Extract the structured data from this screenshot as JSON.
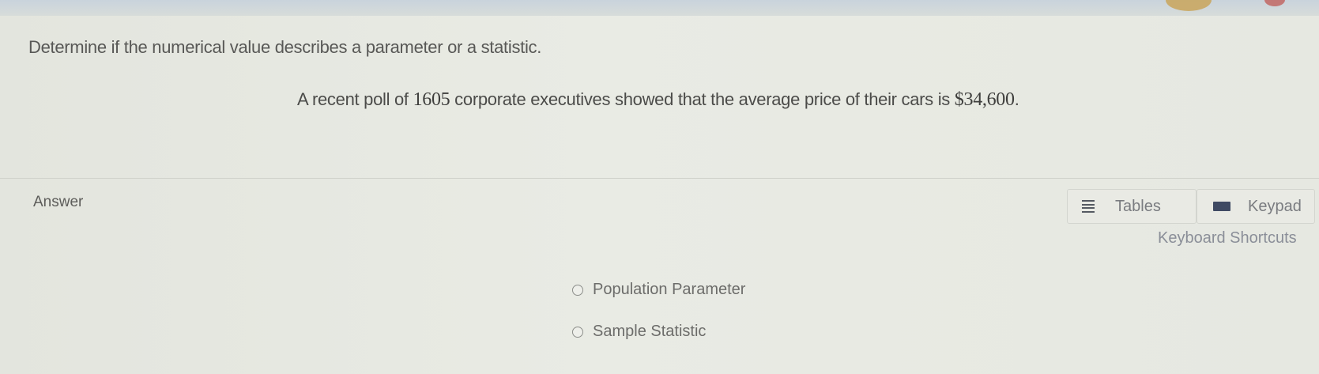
{
  "question": {
    "instruction": "Determine if the numerical value describes a parameter or a statistic.",
    "problem_before": "A recent poll of ",
    "problem_count": "1605",
    "problem_middle": " corporate executives showed that the average price of their cars is ",
    "problem_price": "$34,600",
    "problem_end": "."
  },
  "answer": {
    "label": "Answer",
    "tables_label": "Tables",
    "keypad_label": "Keypad",
    "shortcuts_label": "Keyboard Shortcuts",
    "options": [
      {
        "label": "Population Parameter",
        "selected": false
      },
      {
        "label": "Sample Statistic",
        "selected": false
      }
    ]
  },
  "icons": {
    "tables": "tables-icon",
    "keypad": "keypad-icon"
  }
}
